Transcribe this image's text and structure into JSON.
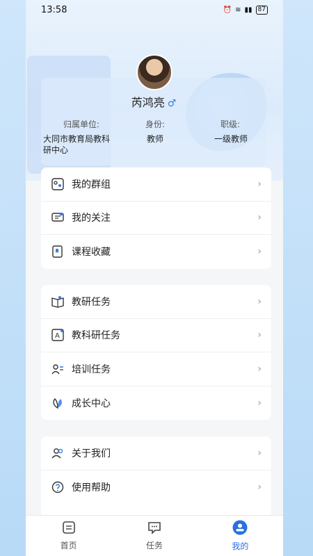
{
  "status_bar": {
    "time": "13:58",
    "battery": "87"
  },
  "profile": {
    "name": "芮鸿亮",
    "gender_symbol": "♂",
    "labels": {
      "unit": "归属单位:",
      "role": "身份:",
      "title": "职级:"
    },
    "values": {
      "unit": "大同市教育局教科研中心",
      "role": "教师",
      "title": "一级教师"
    }
  },
  "group1": [
    {
      "label": "我的群组",
      "icon": "group-icon"
    },
    {
      "label": "我的关注",
      "icon": "follow-icon"
    },
    {
      "label": "课程收藏",
      "icon": "collect-icon"
    }
  ],
  "group2": [
    {
      "label": "教研任务",
      "icon": "research-task-icon"
    },
    {
      "label": "教科研任务",
      "icon": "science-task-icon"
    },
    {
      "label": "培训任务",
      "icon": "training-task-icon"
    },
    {
      "label": "成长中心",
      "icon": "growth-icon"
    }
  ],
  "group3": [
    {
      "label": "关于我们",
      "icon": "about-icon"
    },
    {
      "label": "使用帮助",
      "icon": "help-icon"
    }
  ],
  "tabbar": [
    {
      "label": "首页",
      "icon": "home-icon"
    },
    {
      "label": "任务",
      "icon": "task-icon"
    },
    {
      "label": "我的",
      "icon": "me-icon",
      "active": true
    }
  ],
  "colors": {
    "accent": "#2b6fe0"
  }
}
